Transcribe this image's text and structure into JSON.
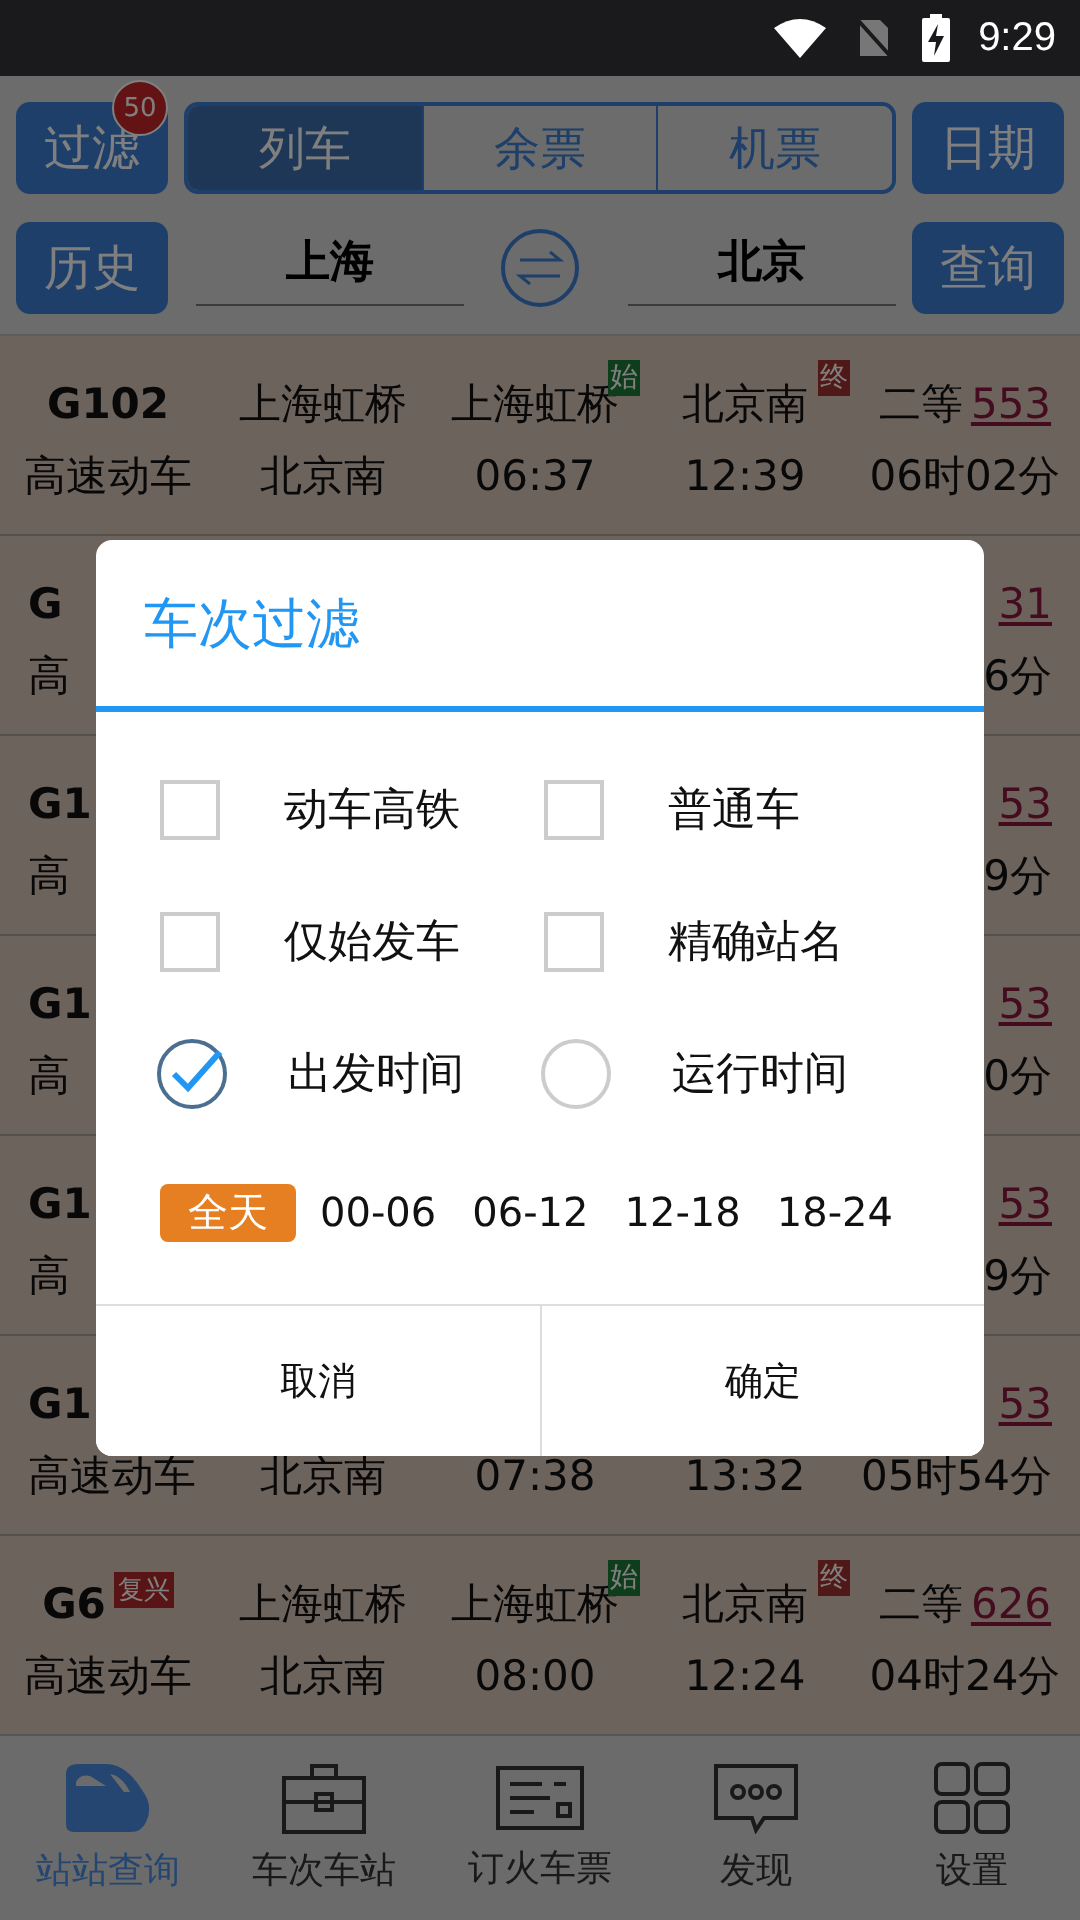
{
  "status_bar": {
    "time": "9:29"
  },
  "header": {
    "filter_button": {
      "label": "过滤",
      "badge": "50"
    },
    "tabs": [
      {
        "label": "列车",
        "selected": true
      },
      {
        "label": "余票",
        "selected": false
      },
      {
        "label": "机票",
        "selected": false
      }
    ],
    "date_button": "日期",
    "history_button": "历史",
    "from_station": "上海",
    "to_station": "北京",
    "query_button": "查询"
  },
  "rows": [
    {
      "kind": "full",
      "train": "G102",
      "type": "高速动车",
      "from": "上海虹桥",
      "to": "北京南",
      "depart_station": "上海虹桥",
      "depart_mark": "始",
      "depart_time": "06:37",
      "arrive_station": "北京南",
      "arrive_mark": "终",
      "arrive_time": "12:39",
      "seat_class": "二等",
      "seats": "553",
      "duration": "06时02分"
    },
    {
      "kind": "partial",
      "train": "G",
      "type": "高",
      "seats": "31",
      "duration": "6分"
    },
    {
      "kind": "partial",
      "train": "G1",
      "type": "高",
      "seats": "53",
      "duration": "9分"
    },
    {
      "kind": "partial",
      "train": "G1",
      "type": "高",
      "seats": "53",
      "duration": "0分"
    },
    {
      "kind": "partial",
      "train": "G1",
      "type": "高",
      "seats": "53",
      "duration": "9分"
    },
    {
      "kind": "partial",
      "train": "G1",
      "type": "高速动车",
      "to": "北京南",
      "depart_time": "07:38",
      "arrive_time": "13:32",
      "seats": "53",
      "duration": "05时54分"
    },
    {
      "kind": "full",
      "train": "G6",
      "train_tag": "复兴",
      "type": "高速动车",
      "from": "上海虹桥",
      "to": "北京南",
      "depart_station": "上海虹桥",
      "depart_mark": "始",
      "depart_time": "08:00",
      "arrive_station": "北京南",
      "arrive_mark": "终",
      "arrive_time": "12:24",
      "seat_class": "二等",
      "seats": "626",
      "duration": "04时24分"
    }
  ],
  "dialog": {
    "title": "车次过滤",
    "options": [
      {
        "kind": "checkbox",
        "label": "动车高铁",
        "checked": false
      },
      {
        "kind": "checkbox",
        "label": "普通车",
        "checked": false
      },
      {
        "kind": "checkbox",
        "label": "仅始发车",
        "checked": false
      },
      {
        "kind": "checkbox",
        "label": "精确站名",
        "checked": false
      },
      {
        "kind": "radio",
        "label": "出发时间",
        "selected": true
      },
      {
        "kind": "radio",
        "label": "运行时间",
        "selected": false
      }
    ],
    "time_ranges": [
      {
        "label": "全天",
        "selected": true
      },
      {
        "label": "00-06",
        "selected": false
      },
      {
        "label": "06-12",
        "selected": false
      },
      {
        "label": "12-18",
        "selected": false
      },
      {
        "label": "18-24",
        "selected": false
      }
    ],
    "buttons": [
      "取消",
      "确定"
    ]
  },
  "bottom_nav": [
    {
      "label": "站站查询",
      "selected": true
    },
    {
      "label": "车次车站",
      "selected": false
    },
    {
      "label": "订火车票",
      "selected": false
    },
    {
      "label": "发现",
      "selected": false
    },
    {
      "label": "设置",
      "selected": false
    }
  ]
}
